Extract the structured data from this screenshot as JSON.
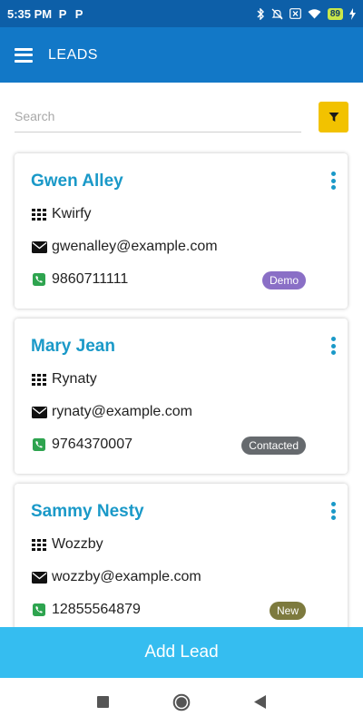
{
  "status_bar": {
    "time": "5:35 PM",
    "notification_icons": [
      "P",
      "P"
    ],
    "battery_level": "89"
  },
  "app_bar": {
    "title": "LEADS"
  },
  "search": {
    "placeholder": "Search",
    "value": ""
  },
  "leads": [
    {
      "name": "Gwen Alley",
      "company": "Kwirfy",
      "email": "gwenalley@example.com",
      "phone": "9860711111",
      "status": "Demo",
      "status_color": "#8a6fc6"
    },
    {
      "name": "Mary Jean",
      "company": "Rynaty",
      "email": "rynaty@example.com",
      "phone": "9764370007",
      "status": "Contacted",
      "status_color": "#666a6e"
    },
    {
      "name": "Sammy Nesty",
      "company": "Wozzby",
      "email": "wozzby@example.com",
      "phone": "12855564879",
      "status": "New",
      "status_color": "#7d7a3e"
    }
  ],
  "add_lead_label": "Add Lead",
  "colors": {
    "status_bar": "#0d5fa8",
    "app_bar": "#1278c7",
    "accent": "#1a99c8",
    "filter_button": "#f2c200",
    "add_button": "#35bdf0",
    "phone_icon": "#2ea44f"
  }
}
